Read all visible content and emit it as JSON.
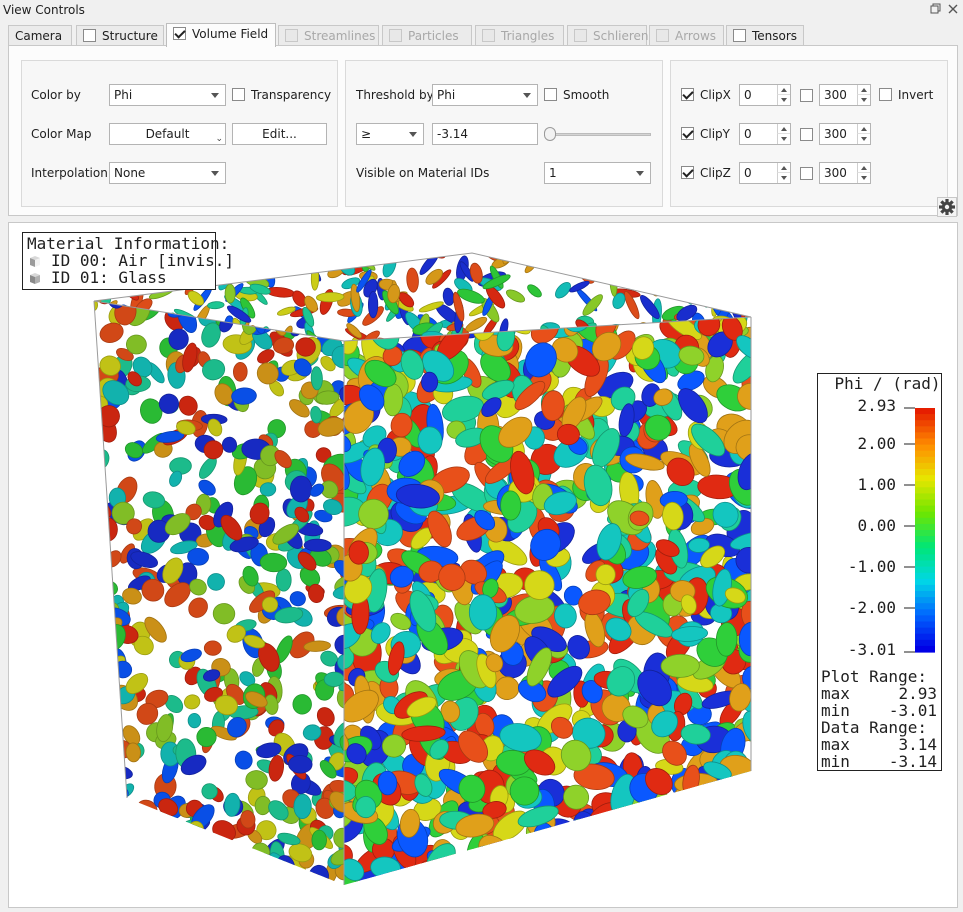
{
  "window": {
    "title": "View Controls"
  },
  "tabs": [
    {
      "label": "Camera",
      "has_checkbox": false,
      "checked": false,
      "enabled": true,
      "active": false
    },
    {
      "label": "Structure",
      "has_checkbox": true,
      "checked": false,
      "enabled": true,
      "active": false
    },
    {
      "label": "Volume Field",
      "has_checkbox": true,
      "checked": true,
      "enabled": true,
      "active": true
    },
    {
      "label": "Streamlines",
      "has_checkbox": true,
      "checked": false,
      "enabled": false,
      "active": false
    },
    {
      "label": "Particles",
      "has_checkbox": true,
      "checked": false,
      "enabled": false,
      "active": false
    },
    {
      "label": "Triangles",
      "has_checkbox": true,
      "checked": false,
      "enabled": false,
      "active": false
    },
    {
      "label": "Schlieren",
      "has_checkbox": true,
      "checked": false,
      "enabled": false,
      "active": false
    },
    {
      "label": "Arrows",
      "has_checkbox": true,
      "checked": false,
      "enabled": false,
      "active": false
    },
    {
      "label": "Tensors",
      "has_checkbox": true,
      "checked": false,
      "enabled": true,
      "active": false
    }
  ],
  "color_group": {
    "color_by_label": "Color by",
    "color_by_value": "Phi",
    "transparency_label": "Transparency",
    "transparency_checked": false,
    "color_map_label": "Color Map",
    "color_map_value": "Default",
    "edit_label": "Edit...",
    "interpolation_label": "Interpolation",
    "interpolation_value": "None"
  },
  "threshold_group": {
    "threshold_by_label": "Threshold by",
    "threshold_by_value": "Phi",
    "smooth_label": "Smooth",
    "smooth_checked": false,
    "operator_value": "≥",
    "threshold_value": "-3.14",
    "threshold_slider_fraction": 0.0,
    "visible_ids_label": "Visible on Material IDs",
    "visible_ids_value": "1"
  },
  "clip_group": {
    "invert_label": "Invert",
    "invert_checked": false,
    "rows": [
      {
        "label": "ClipX",
        "checked": true,
        "min": "0",
        "max_checked": false,
        "max": "300"
      },
      {
        "label": "ClipY",
        "checked": true,
        "min": "0",
        "max_checked": false,
        "max": "300"
      },
      {
        "label": "ClipZ",
        "checked": true,
        "min": "0",
        "max_checked": false,
        "max": "300"
      }
    ]
  },
  "settings_icon": "gear-icon",
  "material_info": {
    "title": "Material Information:",
    "items": [
      {
        "text": "ID 00: Air [invis.]",
        "icon": "cube-icon"
      },
      {
        "text": "ID 01: Glass",
        "icon": "cube-icon"
      }
    ]
  },
  "legend": {
    "title": "Phi / (rad)",
    "ticks": [
      "2.93",
      "2.00",
      "1.00",
      "0.00",
      "-1.00",
      "-2.00",
      "-3.01"
    ],
    "plot_range_label": "Plot Range:",
    "plot_max_label": "max",
    "plot_max": "2.93",
    "plot_min_label": "min",
    "plot_min": "-3.01",
    "data_range_label": "Data Range:",
    "data_max_label": "max",
    "data_max": "3.14",
    "data_min_label": "min",
    "data_min": "-3.14",
    "colormap": [
      "#0000e6",
      "#0066ff",
      "#00d7e6",
      "#00e676",
      "#6ee600",
      "#e6e600",
      "#ff8c00",
      "#e61e00"
    ]
  },
  "colors": {
    "panel_bg": "#f0f0f0",
    "viewport_bg": "#ffffff",
    "particle_palette": [
      "#1a2fd8",
      "#0a58ff",
      "#14c6c0",
      "#1fd09a",
      "#2fcf3a",
      "#8fd22a",
      "#d6d818",
      "#e0a01a",
      "#e8501a",
      "#e02a12"
    ]
  }
}
